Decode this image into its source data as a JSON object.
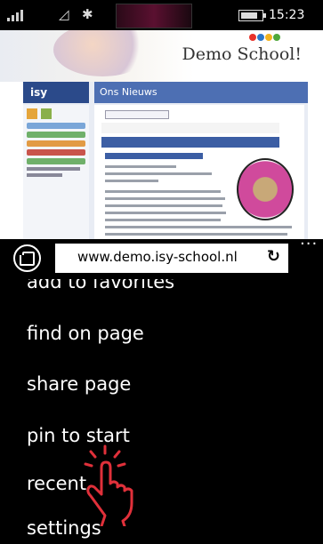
{
  "status_bar": {
    "time": "15:23",
    "signal_icon": "signal-bars-icon",
    "wifi_icon": "wifi-icon",
    "bluetooth_icon": "bluetooth-icon",
    "battery_icon": "battery-icon"
  },
  "web_page": {
    "site_logo": "Demo School!",
    "isy_logo": "isy",
    "news_heading": "Ons Nieuws",
    "logo_colors": [
      "#e8322a",
      "#2b77c9",
      "#f2b21d",
      "#4fa83a"
    ]
  },
  "address_bar": {
    "url": "www.demo.isy-school.nl",
    "refresh_icon": "refresh-icon",
    "tabs_icon": "tabs-icon",
    "more_icon": "more-icon",
    "more_label": "..."
  },
  "menu": {
    "items": [
      {
        "label": "add to favorites"
      },
      {
        "label": "find on page"
      },
      {
        "label": "share page"
      },
      {
        "label": "pin to start"
      },
      {
        "label": "recent"
      },
      {
        "label": "settings"
      }
    ],
    "pointer_icon": "tap-hand-icon",
    "pointer_color": "#e0303a"
  }
}
